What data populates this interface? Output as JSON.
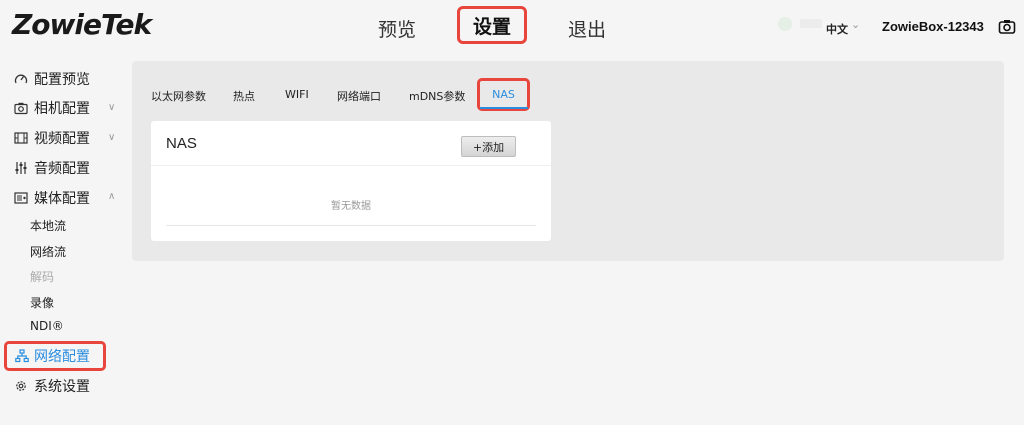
{
  "header": {
    "logo_text": "ZowieTek",
    "nav": {
      "preview": "预览",
      "settings": "设置",
      "exit": "退出"
    },
    "language": "中文",
    "device_name": "ZowieBox-12343",
    "icons": {
      "camera": "camera-icon",
      "chevron": "chevron-down-icon"
    }
  },
  "sidebar": {
    "items": [
      {
        "label": "配置预览",
        "icon": "gauge-icon"
      },
      {
        "label": "相机配置",
        "icon": "camera-icon"
      },
      {
        "label": "视频配置",
        "icon": "film-icon"
      },
      {
        "label": "音频配置",
        "icon": "audio-sliders-icon"
      },
      {
        "label": "媒体配置",
        "icon": "media-icon"
      }
    ],
    "media_sub": [
      "本地流",
      "网络流",
      "解码",
      "录像",
      "NDI®"
    ],
    "active": {
      "label": "网络配置",
      "icon": "network-icon"
    },
    "system": {
      "label": "系统设置",
      "icon": "gear-icon"
    }
  },
  "tabs": {
    "ethernet": "以太网参数",
    "hotspot": "热点",
    "wifi": "WIFI",
    "ports": "网络端口",
    "mdns": "mDNS参数",
    "nas": "NAS"
  },
  "card": {
    "title": "NAS",
    "add_button": "+添加",
    "empty_text": "暂无数据"
  },
  "colors": {
    "accent": "#2a8de0",
    "highlight_border": "#e8453c",
    "panel_bg": "#e9e9e9",
    "page_bg": "#f5f5f5"
  }
}
